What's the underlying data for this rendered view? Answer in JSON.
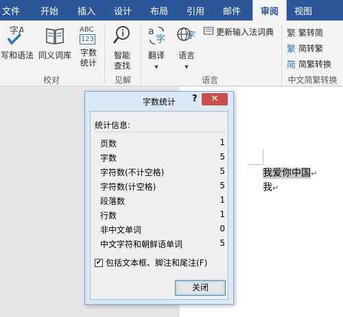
{
  "tabs": [
    {
      "label": "文件"
    },
    {
      "label": "开始"
    },
    {
      "label": "插入"
    },
    {
      "label": "设计"
    },
    {
      "label": "布局"
    },
    {
      "label": "引用"
    },
    {
      "label": "邮件"
    },
    {
      "label": "审阅",
      "active": true
    },
    {
      "label": "视图"
    }
  ],
  "ribbon": {
    "proofing": {
      "spelling_label": "拼写和语法",
      "thesaurus_label": "同义词库",
      "wordcount_label1": "字数",
      "wordcount_label2": "统计",
      "wordcount_icon_text": "ABC",
      "wordcount_icon_num": "123",
      "group_label": "校对"
    },
    "insights": {
      "smart_lookup_label1": "智能",
      "smart_lookup_label2": "查找",
      "group_label": "见解"
    },
    "language": {
      "translate_label": "翻译",
      "language_label": "语言",
      "update_ime_label": "更新输入法词典",
      "group_label": "语言"
    },
    "chinese_conversion": {
      "to_simplified_label": "繁转简",
      "to_traditional_label": "简转繁",
      "convert_label": "简繁转换",
      "group_label": "中文简繁转换"
    }
  },
  "document": {
    "line1": "我爱你中国",
    "line2": "我",
    "para_mark": "↵"
  },
  "dialog": {
    "title": "字数统计",
    "help": "?",
    "close_icon": "✕",
    "stats_header": "统计信息:",
    "stats": [
      {
        "label": "页数",
        "value": "1"
      },
      {
        "label": "字数",
        "value": "5"
      },
      {
        "label": "字符数(不计空格)",
        "value": "5"
      },
      {
        "label": "字符数(计空格)",
        "value": "5"
      },
      {
        "label": "段落数",
        "value": "1"
      },
      {
        "label": "行数",
        "value": "1"
      },
      {
        "label": "非中文单词",
        "value": "0"
      },
      {
        "label": "中文字符和朝鲜语单词",
        "value": "5"
      }
    ],
    "checkbox_label": "包括文本框、脚注和尾注(F)",
    "checkbox_checked": true,
    "close_button": "关闭"
  },
  "colors": {
    "tabbar": "#2b579a",
    "dialog_close": "#c7504a",
    "accent": "#2b579a"
  }
}
